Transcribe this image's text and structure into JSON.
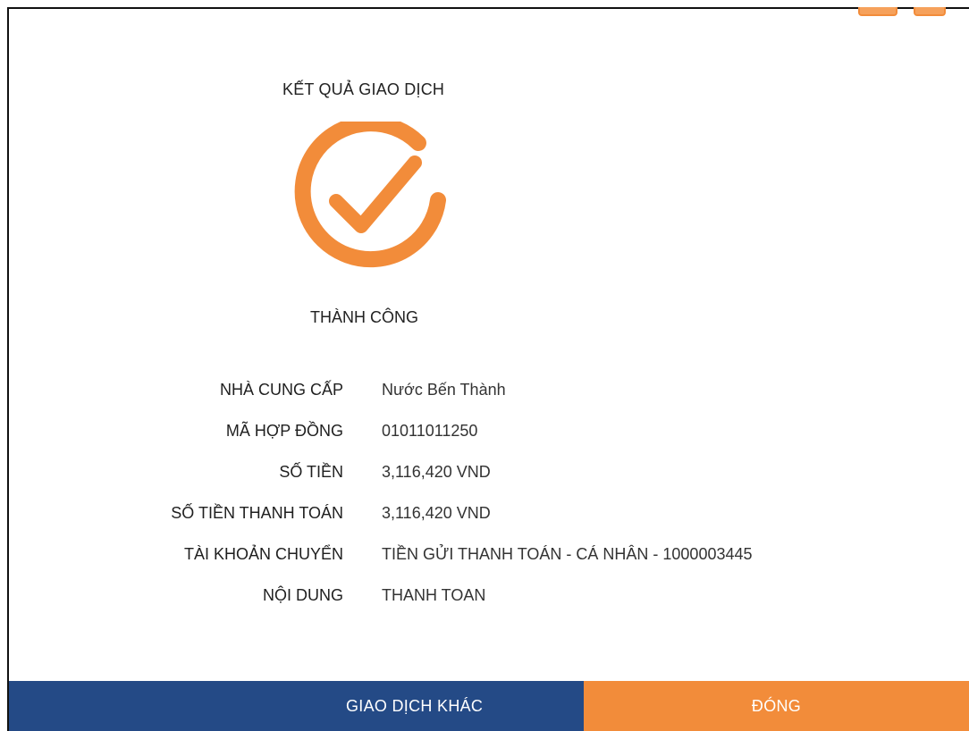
{
  "window": {
    "title": "KẾT QUẢ GIAO DỊCH"
  },
  "status": {
    "icon": "success-check-circle",
    "text": "THÀNH CÔNG"
  },
  "details": [
    {
      "label": "NHÀ CUNG CẤP",
      "value": "Nước Bến Thành"
    },
    {
      "label": "MÃ HỢP ĐỒNG",
      "value": "01011011250"
    },
    {
      "label": "SỐ TIỀN",
      "value": "3,116,420 VND"
    },
    {
      "label": "SỐ TIỀN THANH TOÁN",
      "value": "3,116,420 VND"
    },
    {
      "label": "TÀI KHOẢN CHUYỂN",
      "value": "TIỀN GỬI THANH TOÁN - CÁ NHÂN - 1000003445"
    },
    {
      "label": "NỘI DUNG",
      "value": "THANH TOAN"
    }
  ],
  "footer": {
    "secondary_label": "GIAO DỊCH KHÁC",
    "primary_label": "ĐÓNG"
  },
  "colors": {
    "accent": "#f28c3a",
    "navy": "#244a86",
    "text": "#222222"
  }
}
